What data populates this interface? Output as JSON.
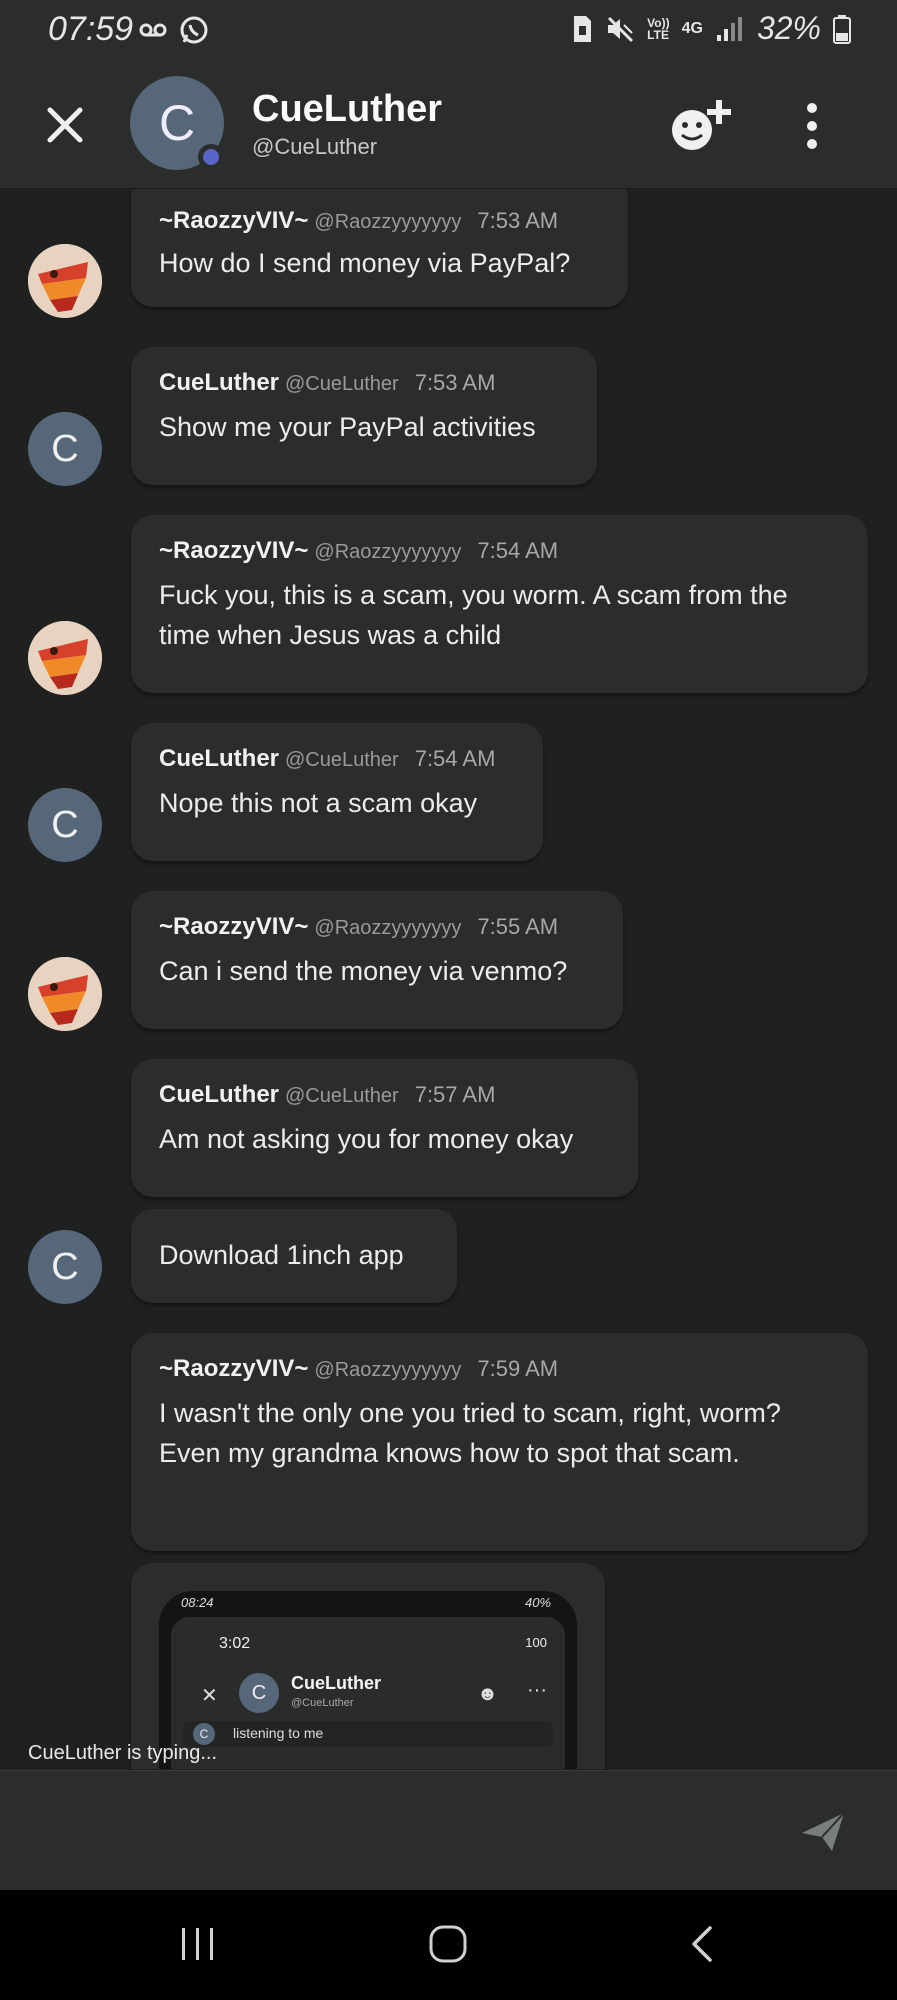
{
  "status_bar": {
    "time": "07:59",
    "battery": "32%",
    "network": "4G",
    "volte": "Vo))\nLTE",
    "icons": [
      "voicemail-icon",
      "whatsapp-icon",
      "sim-icon",
      "mute-icon",
      "signal-icon",
      "battery-icon"
    ]
  },
  "header": {
    "avatar_letter": "C",
    "name": "CueLuther",
    "handle": "@CueLuther",
    "icons": [
      "close-icon",
      "add-friend-icon",
      "more-icon"
    ]
  },
  "messages": [
    {
      "author": "~RaozzyVIV~",
      "handle": "@Raozzyyyyyyy",
      "time": "7:53 AM",
      "text": "How do I send money via PayPal?"
    },
    {
      "author": "CueLuther",
      "handle": "@CueLuther",
      "time": "7:53 AM",
      "text": "Show me your PayPal activities",
      "avatar_letter": "C"
    },
    {
      "author": "~RaozzyVIV~",
      "handle": "@Raozzyyyyyyy",
      "time": "7:54 AM",
      "text": "Fuck you, this is a scam, you worm. A scam from the time when Jesus was a child"
    },
    {
      "author": "CueLuther",
      "handle": "@CueLuther",
      "time": "7:54 AM",
      "text": "Nope this not a scam okay",
      "avatar_letter": "C"
    },
    {
      "author": "~RaozzyVIV~",
      "handle": "@Raozzyyyyyyy",
      "time": "7:55 AM",
      "text": "Can i send the money via venmo?"
    },
    {
      "author": "CueLuther",
      "handle": "@CueLuther",
      "time": "7:57 AM",
      "text": "Am not asking you for money okay",
      "avatar_letter": "C"
    },
    {
      "text": "Download 1inch app",
      "avatar_letter": "C"
    },
    {
      "author": "~RaozzyVIV~",
      "handle": "@Raozzyyyyyyy",
      "time": "7:59 AM",
      "text": "I wasn't the only one you tried to scam, right, worm? Even my grandma knows how to spot that scam."
    }
  ],
  "attachment": {
    "time": "08:24",
    "battery": "40%",
    "inner_time": "3:02",
    "inner_battery": "100",
    "avatar_letter": "C",
    "name": "CueLuther",
    "handle": "@CueLuther",
    "message": "listening to me"
  },
  "typing_indicator": "CueLuther is typing...",
  "colors": {
    "background": "#1f2020",
    "bubble": "#2a2d2c",
    "avatar": "#56677a",
    "presence": "#5865c6"
  }
}
